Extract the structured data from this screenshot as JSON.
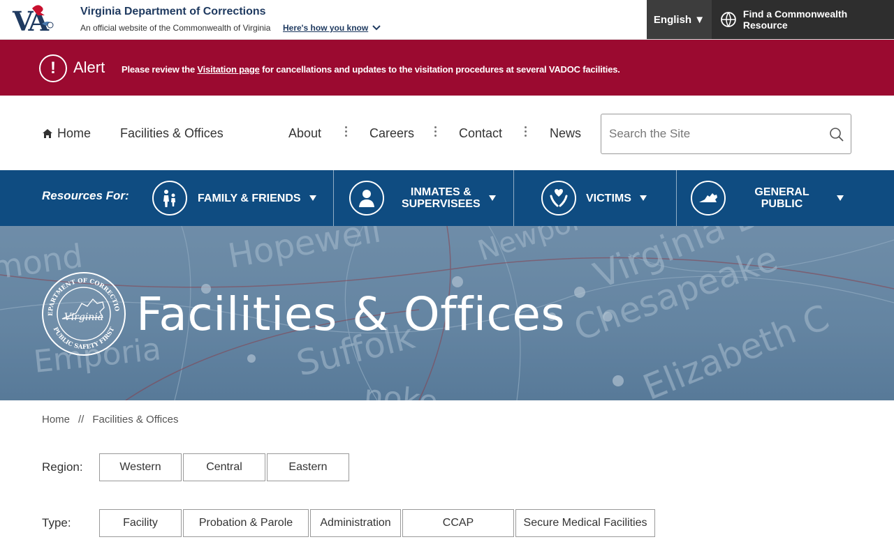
{
  "topbar": {
    "logo_text": "VA",
    "dept_name": "Virginia Department of Corrections",
    "official_text": "An official website of the Commonwealth of Virginia",
    "how_know_link": "Here's how you know",
    "language": "English ▼",
    "resource_button": "Find a Commonwealth Resource"
  },
  "alert": {
    "icon": "!",
    "title": "Alert",
    "message_prefix": "Please review the ",
    "message_link": "Visitation page",
    "message_suffix": " for cancellations and updates to the visitation procedures at several VADOC facilities."
  },
  "nav": {
    "home": "Home",
    "facilities": "Facilities & Offices",
    "about": "About",
    "careers": "Careers",
    "contact": "Contact",
    "news": "News",
    "search_placeholder": "Search the Site"
  },
  "resources": {
    "label": "Resources For:",
    "items": [
      {
        "label": "FAMILY & FRIENDS",
        "icon": "family-icon"
      },
      {
        "label_line1": "INMATES &",
        "label_line2": "SUPERVISEES",
        "icon": "person-icon"
      },
      {
        "label": "VICTIMS",
        "icon": "hands-heart-icon"
      },
      {
        "label": "GENERAL PUBLIC",
        "icon": "virginia-map-icon"
      }
    ]
  },
  "hero": {
    "title": "Facilities & Offices",
    "seal_top": "DEPARTMENT OF CORRECTIONS",
    "seal_center": "Virginia",
    "seal_bottom": "PUBLIC SAFETY FIRST",
    "map_labels": [
      "mond",
      "Hopewell",
      "Newport",
      "Virginia B",
      "Emporia",
      "Suffolk",
      "Chesapeake",
      "Elizabeth C",
      "noke"
    ]
  },
  "breadcrumb": {
    "home": "Home",
    "separator": "//",
    "current": "Facilities & Offices"
  },
  "filters": {
    "region_label": "Region:",
    "regions": [
      "Western",
      "Central",
      "Eastern"
    ],
    "type_label": "Type:",
    "types": [
      "Facility",
      "Probation & Parole",
      "Administration",
      "CCAP",
      "Secure Medical Facilities"
    ]
  },
  "colors": {
    "alert_bg": "#9b0a30",
    "resources_bg": "#0f4c81",
    "brand_navy": "#1f3a60"
  }
}
